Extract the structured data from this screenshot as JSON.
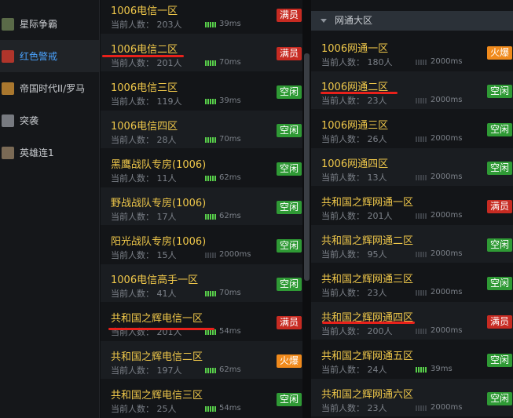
{
  "sidebar": {
    "games": [
      {
        "label": "星际争霸",
        "icon": "starcraft-icon",
        "active": false,
        "color": "#5a6a48"
      },
      {
        "label": "红色警戒",
        "icon": "red-alert-icon",
        "active": true,
        "color": "#b0352b"
      },
      {
        "label": "帝国时代II/罗马",
        "icon": "age-of-empires-icon",
        "active": false,
        "color": "#a9772e"
      },
      {
        "label": "突袭",
        "icon": "sudden-strike-icon",
        "active": false,
        "color": "#777a80"
      },
      {
        "label": "英雄连1",
        "icon": "company-of-heroes-icon",
        "active": false,
        "color": "#7a6a55"
      }
    ]
  },
  "telecom": {
    "rows": [
      {
        "name": "1006电信一区",
        "count": "当前人数： 203人",
        "ping": "39ms",
        "signal": "green",
        "status": "满员",
        "status_type": "full"
      },
      {
        "name": "1006电信二区",
        "count": "当前人数： 201人",
        "ping": "70ms",
        "signal": "green",
        "status": "满员",
        "status_type": "full"
      },
      {
        "name": "1006电信三区",
        "count": "当前人数： 119人",
        "ping": "39ms",
        "signal": "green",
        "status": "空闲",
        "status_type": "idle"
      },
      {
        "name": "1006电信四区",
        "count": "当前人数： 28人",
        "ping": "70ms",
        "signal": "green",
        "status": "空闲",
        "status_type": "idle"
      },
      {
        "name": "黑鹰战队专房(1006)",
        "count": "当前人数： 11人",
        "ping": "62ms",
        "signal": "green",
        "status": "空闲",
        "status_type": "idle"
      },
      {
        "name": "野战战队专房(1006)",
        "count": "当前人数： 17人",
        "ping": "62ms",
        "signal": "green",
        "status": "空闲",
        "status_type": "idle"
      },
      {
        "name": "阳光战队专房(1006)",
        "count": "当前人数： 15人",
        "ping": "2000ms",
        "signal": "gray",
        "status": "空闲",
        "status_type": "idle"
      },
      {
        "name": "1006电信高手一区",
        "count": "当前人数： 41人",
        "ping": "70ms",
        "signal": "green",
        "status": "空闲",
        "status_type": "idle"
      },
      {
        "name": "共和国之辉电信一区",
        "count": "当前人数： 201人",
        "ping": "54ms",
        "signal": "green",
        "status": "满员",
        "status_type": "full"
      },
      {
        "name": "共和国之辉电信二区",
        "count": "当前人数： 197人",
        "ping": "62ms",
        "signal": "green",
        "status": "火爆",
        "status_type": "hot"
      },
      {
        "name": "共和国之辉电信三区",
        "count": "当前人数： 25人",
        "ping": "54ms",
        "signal": "green",
        "status": "空闲",
        "status_type": "idle"
      }
    ]
  },
  "netcom": {
    "header": "网通大区",
    "rows": [
      {
        "name": "1006网通一区",
        "count": "当前人数： 180人",
        "ping": "2000ms",
        "signal": "gray",
        "status": "火爆",
        "status_type": "hot"
      },
      {
        "name": "1006网通二区",
        "count": "当前人数： 23人",
        "ping": "2000ms",
        "signal": "gray",
        "status": "空闲",
        "status_type": "idle"
      },
      {
        "name": "1006网通三区",
        "count": "当前人数： 26人",
        "ping": "2000ms",
        "signal": "gray",
        "status": "空闲",
        "status_type": "idle"
      },
      {
        "name": "1006网通四区",
        "count": "当前人数： 13人",
        "ping": "2000ms",
        "signal": "gray",
        "status": "空闲",
        "status_type": "idle"
      },
      {
        "name": "共和国之辉网通一区",
        "count": "当前人数： 201人",
        "ping": "2000ms",
        "signal": "gray",
        "status": "满员",
        "status_type": "full"
      },
      {
        "name": "共和国之辉网通二区",
        "count": "当前人数： 95人",
        "ping": "2000ms",
        "signal": "gray",
        "status": "空闲",
        "status_type": "idle"
      },
      {
        "name": "共和国之辉网通三区",
        "count": "当前人数： 23人",
        "ping": "2000ms",
        "signal": "gray",
        "status": "空闲",
        "status_type": "idle"
      },
      {
        "name": "共和国之辉网通四区",
        "count": "当前人数： 200人",
        "ping": "2000ms",
        "signal": "gray",
        "status": "满员",
        "status_type": "full"
      },
      {
        "name": "共和国之辉网通五区",
        "count": "当前人数： 24人",
        "ping": "39ms",
        "signal": "green",
        "status": "空闲",
        "status_type": "idle"
      },
      {
        "name": "共和国之辉网通六区",
        "count": "当前人数： 23人",
        "ping": "2000ms",
        "signal": "gray",
        "status": "空闲",
        "status_type": "idle"
      }
    ]
  }
}
